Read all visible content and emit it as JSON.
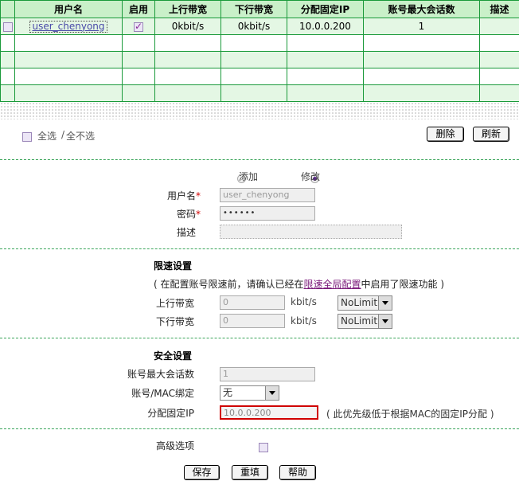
{
  "table": {
    "headers": [
      "用户名",
      "启用",
      "上行带宽",
      "下行带宽",
      "分配固定IP",
      "账号最大会话数",
      "描述"
    ],
    "row": {
      "username": "user_chenyong",
      "up": "0kbit/s",
      "down": "0kbit/s",
      "ip": "10.0.0.200",
      "sessions": "1",
      "desc": ""
    }
  },
  "select_all": {
    "label": "全选",
    "sep": "/",
    "label2": "全不选"
  },
  "buttons": {
    "delete": "删除",
    "refresh": "刷新",
    "save": "保存",
    "reset": "重填",
    "help": "帮助"
  },
  "mode": {
    "add": "添加",
    "edit": "修改"
  },
  "form": {
    "username_label": "用户名",
    "username_value": "user_chenyong",
    "password_label": "密码",
    "password_value": "••••••",
    "desc_label": "描述",
    "desc_value": "",
    "req_mark": "*"
  },
  "speed": {
    "title": "限速设置",
    "note_pre": "( 在配置账号限速前，请确认已经在",
    "note_link": "限速全局配置",
    "note_post": "中启用了限速功能 )",
    "up_label": "上行带宽",
    "up_value": "0",
    "down_label": "下行带宽",
    "down_value": "0",
    "unit": "kbit/s",
    "limit_option": "NoLimit"
  },
  "security": {
    "title": "安全设置",
    "sessions_label": "账号最大会话数",
    "sessions_value": "1",
    "mac_label": "账号/MAC绑定",
    "mac_value": "无",
    "ip_label": "分配固定IP",
    "ip_value": "10.0.0.200",
    "ip_note": "( 此优先级低于根据MAC的固定IP分配 )"
  },
  "advanced": {
    "label": "高级选项"
  }
}
